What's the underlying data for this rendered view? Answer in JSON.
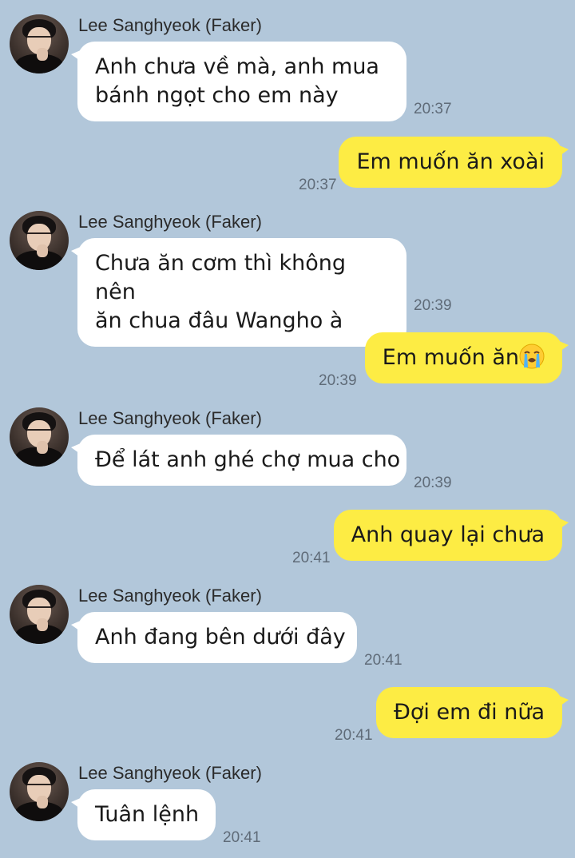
{
  "chat": {
    "contact_name": "Lee Sanghyeok (Faker)",
    "messages": [
      {
        "from": "contact",
        "sender": "Lee Sanghyeok (Faker)",
        "line1": "Anh chưa về mà, anh mua",
        "line2": "bánh ngọt cho em này",
        "time": "20:37"
      },
      {
        "from": "me",
        "text": "Em muốn ăn xoài",
        "time": "20:37"
      },
      {
        "from": "contact",
        "sender": "Lee Sanghyeok (Faker)",
        "line1": "Chưa ăn cơm thì không nên",
        "line2": "ăn chua đâu Wangho à",
        "time": "20:39"
      },
      {
        "from": "me",
        "text": "Em muốn ăn",
        "emoji": "loudly-crying-face",
        "time": "20:39"
      },
      {
        "from": "contact",
        "sender": "Lee Sanghyeok (Faker)",
        "text": "Để lát anh ghé chợ mua cho",
        "time": "20:39"
      },
      {
        "from": "me",
        "text": "Anh quay lại chưa",
        "time": "20:41"
      },
      {
        "from": "contact",
        "sender": "Lee Sanghyeok (Faker)",
        "text": "Anh đang bên dưới đây",
        "time": "20:41"
      },
      {
        "from": "me",
        "text": "Đợi em đi nữa",
        "time": "20:41"
      },
      {
        "from": "contact",
        "sender": "Lee Sanghyeok (Faker)",
        "text": "Tuân lệnh",
        "time": "20:41"
      }
    ]
  },
  "colors": {
    "background": "#b2c7da",
    "outgoing_bubble": "#fdec44",
    "incoming_bubble": "#ffffff",
    "time_text": "#5f6b78"
  }
}
